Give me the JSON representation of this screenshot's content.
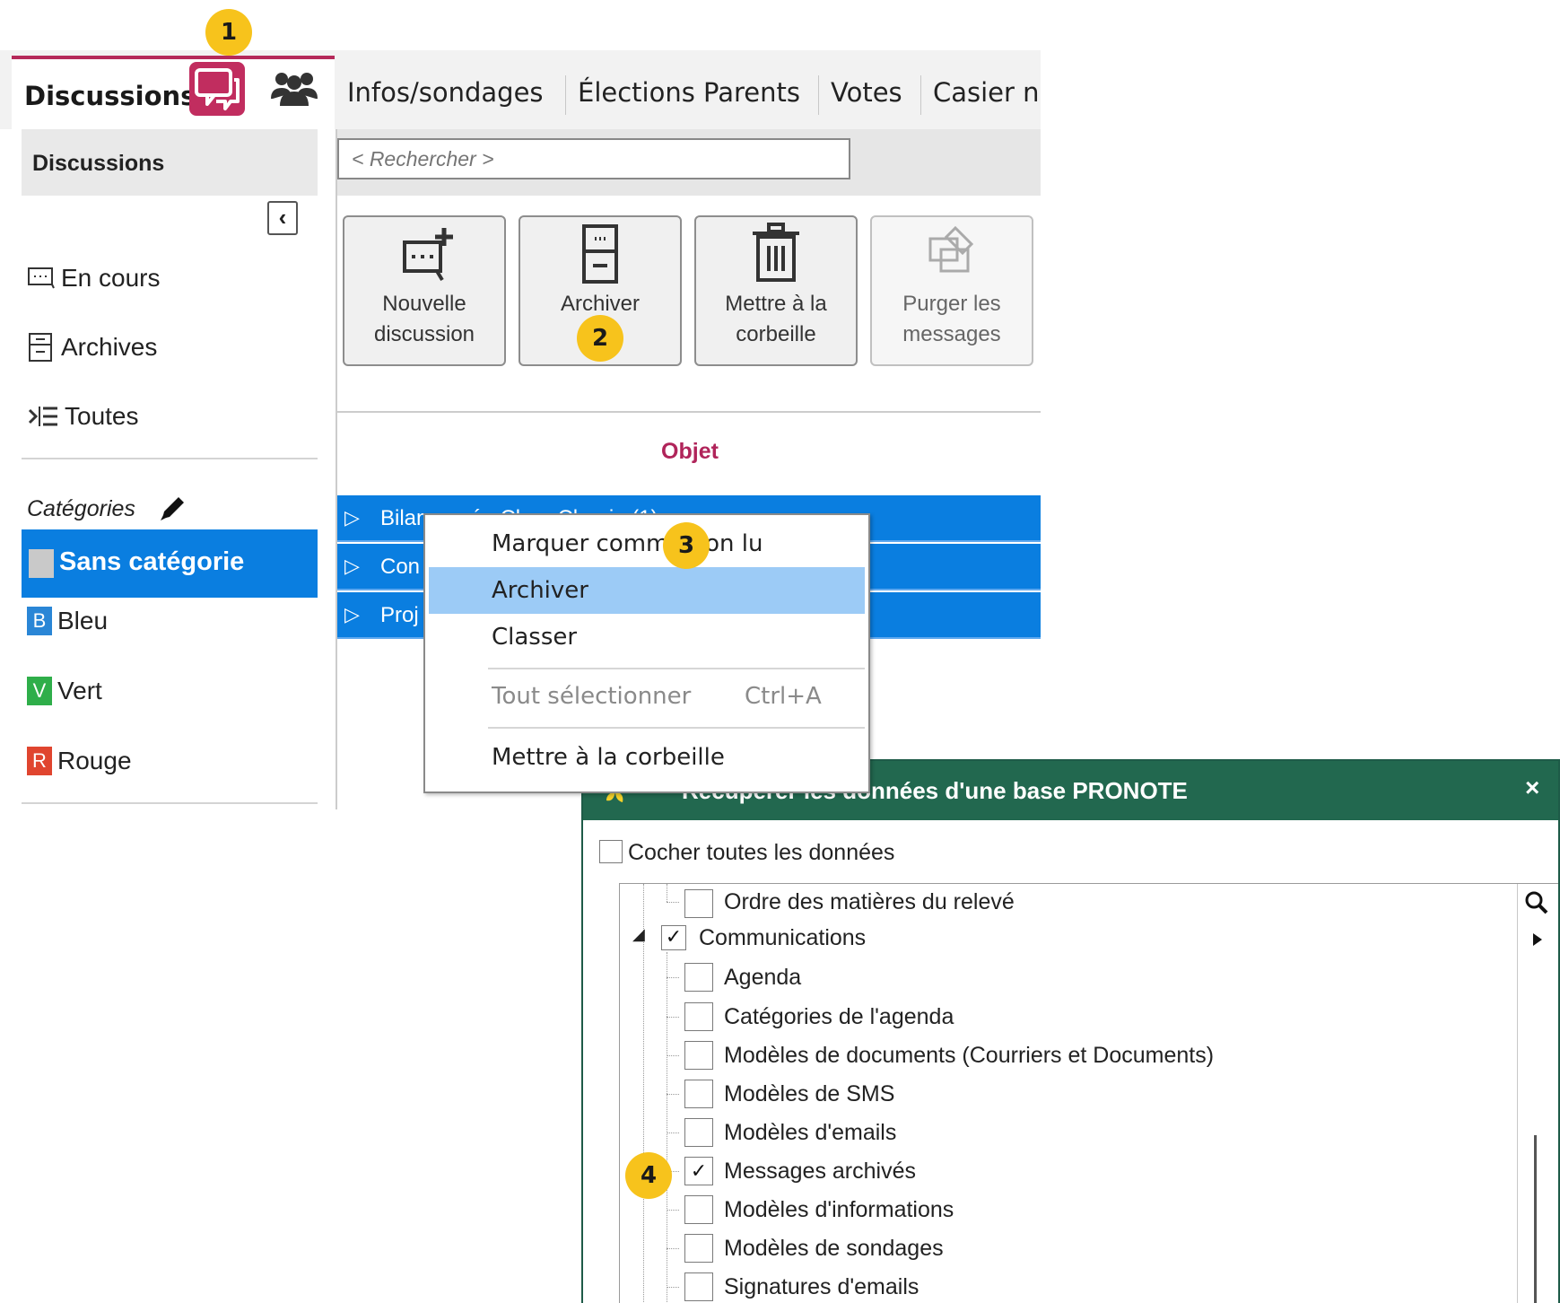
{
  "badges": [
    "1",
    "2",
    "3",
    "4"
  ],
  "tabs": {
    "active": "Discussions",
    "others": [
      "Infos/sondages",
      "Élections Parents",
      "Votes",
      "Casier nu"
    ]
  },
  "sidebar": {
    "header": "Discussions",
    "items": [
      "En cours",
      "Archives",
      "Toutes"
    ],
    "categories_label": "Catégories",
    "selected_category": "Sans catégorie",
    "categories": [
      {
        "letter": "B",
        "label": "Bleu",
        "color": "#2a86d6"
      },
      {
        "letter": "V",
        "label": "Vert",
        "color": "#2fae4a"
      },
      {
        "letter": "R",
        "label": "Rouge",
        "color": "#e0452f"
      }
    ]
  },
  "search": {
    "placeholder": "< Rechercher >"
  },
  "toolbar": [
    {
      "line1": "Nouvelle",
      "line2": "discussion"
    },
    {
      "line1": "Archiver",
      "line2": ""
    },
    {
      "line1": "Mettre à la",
      "line2": "corbeille"
    },
    {
      "line1": "Purger les",
      "line2": "messages"
    }
  ],
  "list": {
    "column": "Objet",
    "rows": [
      "Bilan année Clara Chopin (1)",
      "Con",
      "Proj"
    ]
  },
  "context_menu": {
    "items": [
      "Marquer comme non lu",
      "Archiver",
      "Classer"
    ],
    "disabled_item": "Tout sélectionner",
    "shortcut": "Ctrl+A",
    "last_item": "Mettre à la corbeille"
  },
  "dialog": {
    "title": "Récupérer les données d'une base PRONOTE",
    "close": "×",
    "check_all": "Cocher toutes les données",
    "tree": [
      {
        "label": "Ordre des matières du relevé",
        "checked": false,
        "level": 2
      },
      {
        "label": "Communications",
        "checked": true,
        "level": 1
      },
      {
        "label": "Agenda",
        "checked": false,
        "level": 2
      },
      {
        "label": "Catégories de l'agenda",
        "checked": false,
        "level": 2
      },
      {
        "label": "Modèles de documents (Courriers et Documents)",
        "checked": false,
        "level": 2
      },
      {
        "label": "Modèles de SMS",
        "checked": false,
        "level": 2
      },
      {
        "label": "Modèles d'emails",
        "checked": false,
        "level": 2
      },
      {
        "label": "Messages archivés",
        "checked": true,
        "level": 2
      },
      {
        "label": "Modèles d'informations",
        "checked": false,
        "level": 2
      },
      {
        "label": "Modèles de sondages",
        "checked": false,
        "level": 2
      },
      {
        "label": "Signatures d'emails",
        "checked": false,
        "level": 2
      }
    ]
  },
  "colors": {
    "accent": "#c12d5f",
    "selection": "#0a7ee0",
    "dialog_header": "#22684f",
    "badge": "#f7c31c"
  }
}
